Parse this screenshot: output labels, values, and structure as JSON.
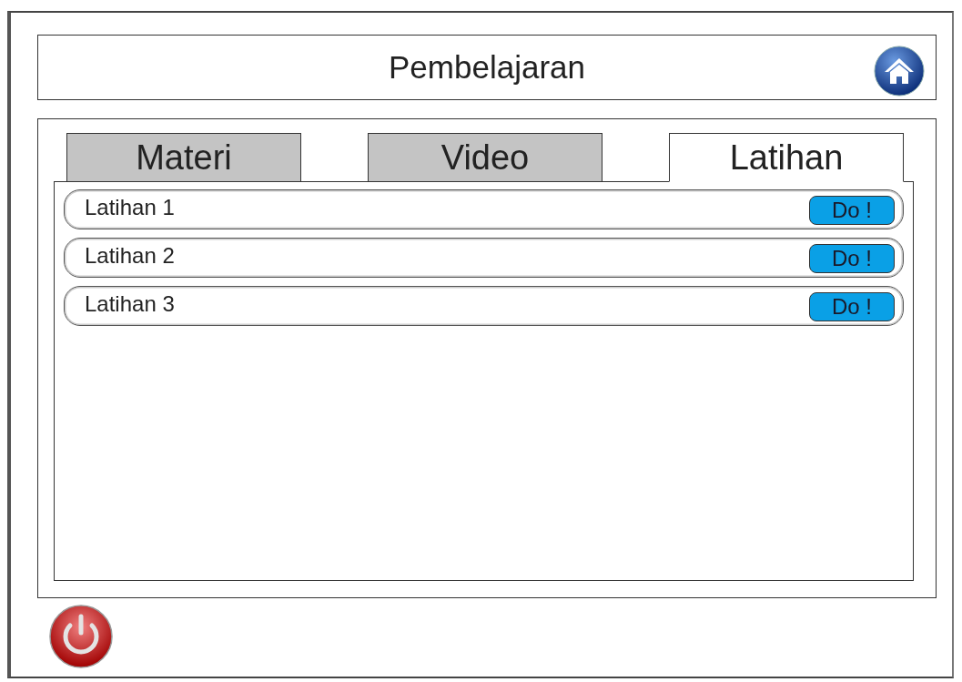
{
  "header": {
    "title": "Pembelajaran"
  },
  "tabs": [
    {
      "label": "Materi",
      "selected": false
    },
    {
      "label": "Video",
      "selected": false
    },
    {
      "label": "Latihan",
      "selected": true
    }
  ],
  "exercises": [
    {
      "label": "Latihan 1",
      "button": "Do !"
    },
    {
      "label": "Latihan 2",
      "button": "Do !"
    },
    {
      "label": "Latihan 3",
      "button": "Do !"
    }
  ]
}
